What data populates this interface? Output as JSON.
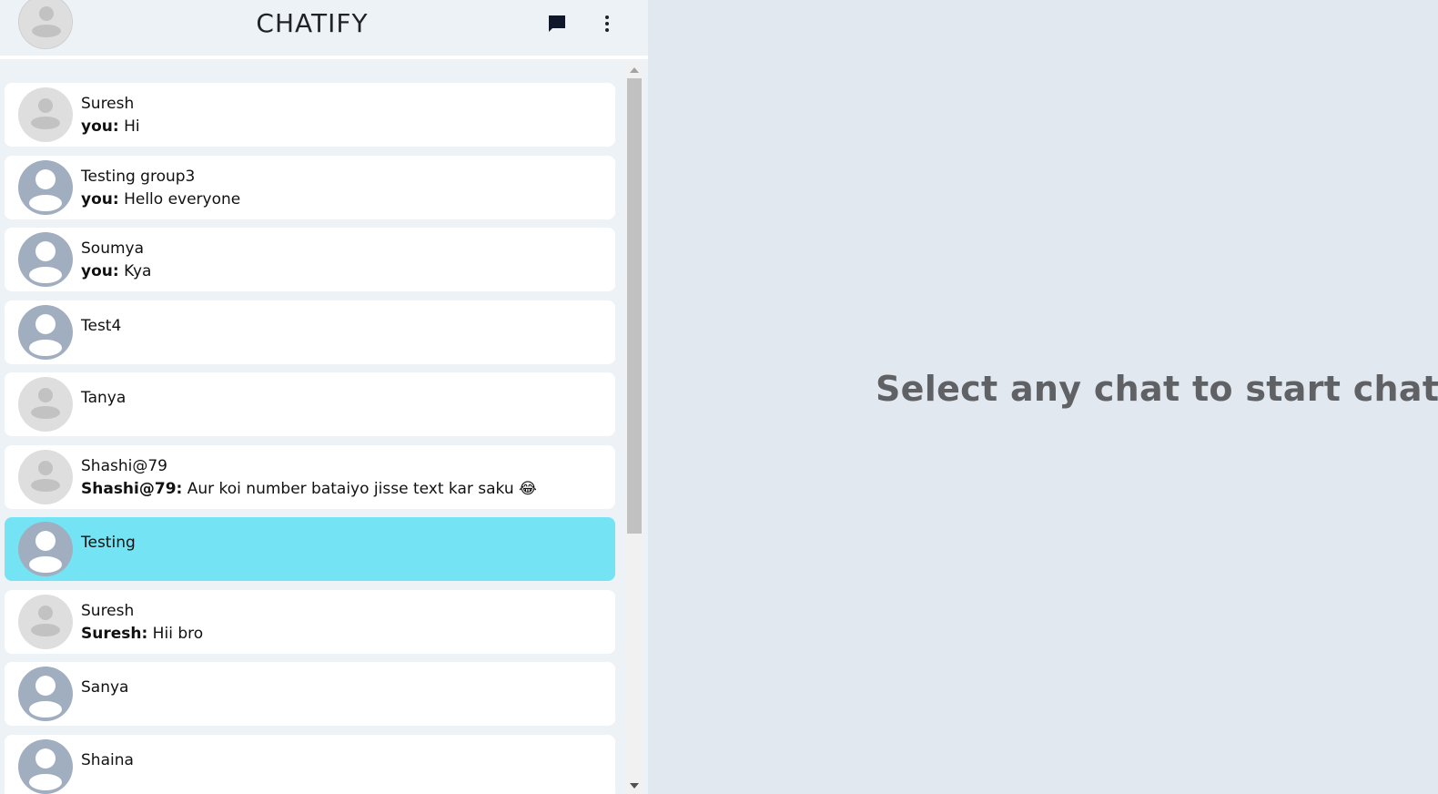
{
  "app": {
    "title": "CHATIFY",
    "icons": {
      "new_chat": "chat-bubble-icon",
      "menu": "vertical-dots-icon",
      "avatar": "default-user-avatar"
    }
  },
  "chats": [
    {
      "name": "Suresh",
      "sender": "you:",
      "message": " Hi",
      "avatar": "light"
    },
    {
      "name": "Testing group3",
      "sender": "you:",
      "message": " Hello everyone",
      "avatar": "dark"
    },
    {
      "name": "Soumya",
      "sender": "you:",
      "message": " Kya",
      "avatar": "dark"
    },
    {
      "name": "Test4",
      "avatar": "dark"
    },
    {
      "name": "Tanya",
      "avatar": "light"
    },
    {
      "name": "Shashi@79",
      "sender": "Shashi@79:",
      "message": " Aur koi number bataiyo jisse text kar saku 😂",
      "avatar": "light"
    },
    {
      "name": "Testing",
      "avatar": "dark",
      "active": true
    },
    {
      "name": "Suresh",
      "sender": "Suresh:",
      "message": " Hii bro",
      "avatar": "light"
    },
    {
      "name": "Sanya",
      "avatar": "dark"
    },
    {
      "name": "Shaina",
      "avatar": "dark"
    }
  ],
  "main": {
    "placeholder": "Select any chat to start chating"
  },
  "colors": {
    "active_chat": "#74e4f5",
    "background": "#e2e8f0",
    "sidebar": "#edf2f7"
  }
}
